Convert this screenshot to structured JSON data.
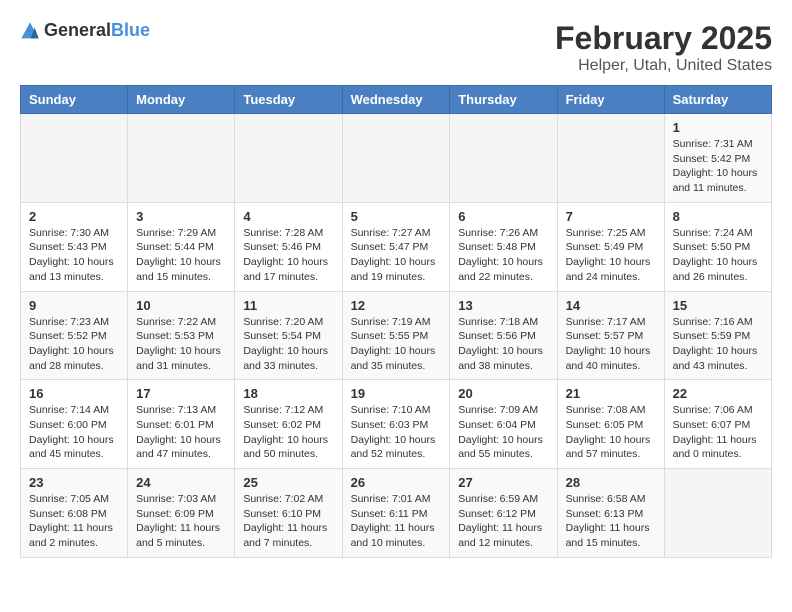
{
  "header": {
    "logo_general": "General",
    "logo_blue": "Blue",
    "main_title": "February 2025",
    "subtitle": "Helper, Utah, United States"
  },
  "calendar": {
    "days_of_week": [
      "Sunday",
      "Monday",
      "Tuesday",
      "Wednesday",
      "Thursday",
      "Friday",
      "Saturday"
    ],
    "weeks": [
      [
        {
          "day": "",
          "info": ""
        },
        {
          "day": "",
          "info": ""
        },
        {
          "day": "",
          "info": ""
        },
        {
          "day": "",
          "info": ""
        },
        {
          "day": "",
          "info": ""
        },
        {
          "day": "",
          "info": ""
        },
        {
          "day": "1",
          "info": "Sunrise: 7:31 AM\nSunset: 5:42 PM\nDaylight: 10 hours and 11 minutes."
        }
      ],
      [
        {
          "day": "2",
          "info": "Sunrise: 7:30 AM\nSunset: 5:43 PM\nDaylight: 10 hours and 13 minutes."
        },
        {
          "day": "3",
          "info": "Sunrise: 7:29 AM\nSunset: 5:44 PM\nDaylight: 10 hours and 15 minutes."
        },
        {
          "day": "4",
          "info": "Sunrise: 7:28 AM\nSunset: 5:46 PM\nDaylight: 10 hours and 17 minutes."
        },
        {
          "day": "5",
          "info": "Sunrise: 7:27 AM\nSunset: 5:47 PM\nDaylight: 10 hours and 19 minutes."
        },
        {
          "day": "6",
          "info": "Sunrise: 7:26 AM\nSunset: 5:48 PM\nDaylight: 10 hours and 22 minutes."
        },
        {
          "day": "7",
          "info": "Sunrise: 7:25 AM\nSunset: 5:49 PM\nDaylight: 10 hours and 24 minutes."
        },
        {
          "day": "8",
          "info": "Sunrise: 7:24 AM\nSunset: 5:50 PM\nDaylight: 10 hours and 26 minutes."
        }
      ],
      [
        {
          "day": "9",
          "info": "Sunrise: 7:23 AM\nSunset: 5:52 PM\nDaylight: 10 hours and 28 minutes."
        },
        {
          "day": "10",
          "info": "Sunrise: 7:22 AM\nSunset: 5:53 PM\nDaylight: 10 hours and 31 minutes."
        },
        {
          "day": "11",
          "info": "Sunrise: 7:20 AM\nSunset: 5:54 PM\nDaylight: 10 hours and 33 minutes."
        },
        {
          "day": "12",
          "info": "Sunrise: 7:19 AM\nSunset: 5:55 PM\nDaylight: 10 hours and 35 minutes."
        },
        {
          "day": "13",
          "info": "Sunrise: 7:18 AM\nSunset: 5:56 PM\nDaylight: 10 hours and 38 minutes."
        },
        {
          "day": "14",
          "info": "Sunrise: 7:17 AM\nSunset: 5:57 PM\nDaylight: 10 hours and 40 minutes."
        },
        {
          "day": "15",
          "info": "Sunrise: 7:16 AM\nSunset: 5:59 PM\nDaylight: 10 hours and 43 minutes."
        }
      ],
      [
        {
          "day": "16",
          "info": "Sunrise: 7:14 AM\nSunset: 6:00 PM\nDaylight: 10 hours and 45 minutes."
        },
        {
          "day": "17",
          "info": "Sunrise: 7:13 AM\nSunset: 6:01 PM\nDaylight: 10 hours and 47 minutes."
        },
        {
          "day": "18",
          "info": "Sunrise: 7:12 AM\nSunset: 6:02 PM\nDaylight: 10 hours and 50 minutes."
        },
        {
          "day": "19",
          "info": "Sunrise: 7:10 AM\nSunset: 6:03 PM\nDaylight: 10 hours and 52 minutes."
        },
        {
          "day": "20",
          "info": "Sunrise: 7:09 AM\nSunset: 6:04 PM\nDaylight: 10 hours and 55 minutes."
        },
        {
          "day": "21",
          "info": "Sunrise: 7:08 AM\nSunset: 6:05 PM\nDaylight: 10 hours and 57 minutes."
        },
        {
          "day": "22",
          "info": "Sunrise: 7:06 AM\nSunset: 6:07 PM\nDaylight: 11 hours and 0 minutes."
        }
      ],
      [
        {
          "day": "23",
          "info": "Sunrise: 7:05 AM\nSunset: 6:08 PM\nDaylight: 11 hours and 2 minutes."
        },
        {
          "day": "24",
          "info": "Sunrise: 7:03 AM\nSunset: 6:09 PM\nDaylight: 11 hours and 5 minutes."
        },
        {
          "day": "25",
          "info": "Sunrise: 7:02 AM\nSunset: 6:10 PM\nDaylight: 11 hours and 7 minutes."
        },
        {
          "day": "26",
          "info": "Sunrise: 7:01 AM\nSunset: 6:11 PM\nDaylight: 11 hours and 10 minutes."
        },
        {
          "day": "27",
          "info": "Sunrise: 6:59 AM\nSunset: 6:12 PM\nDaylight: 11 hours and 12 minutes."
        },
        {
          "day": "28",
          "info": "Sunrise: 6:58 AM\nSunset: 6:13 PM\nDaylight: 11 hours and 15 minutes."
        },
        {
          "day": "",
          "info": ""
        }
      ]
    ]
  }
}
